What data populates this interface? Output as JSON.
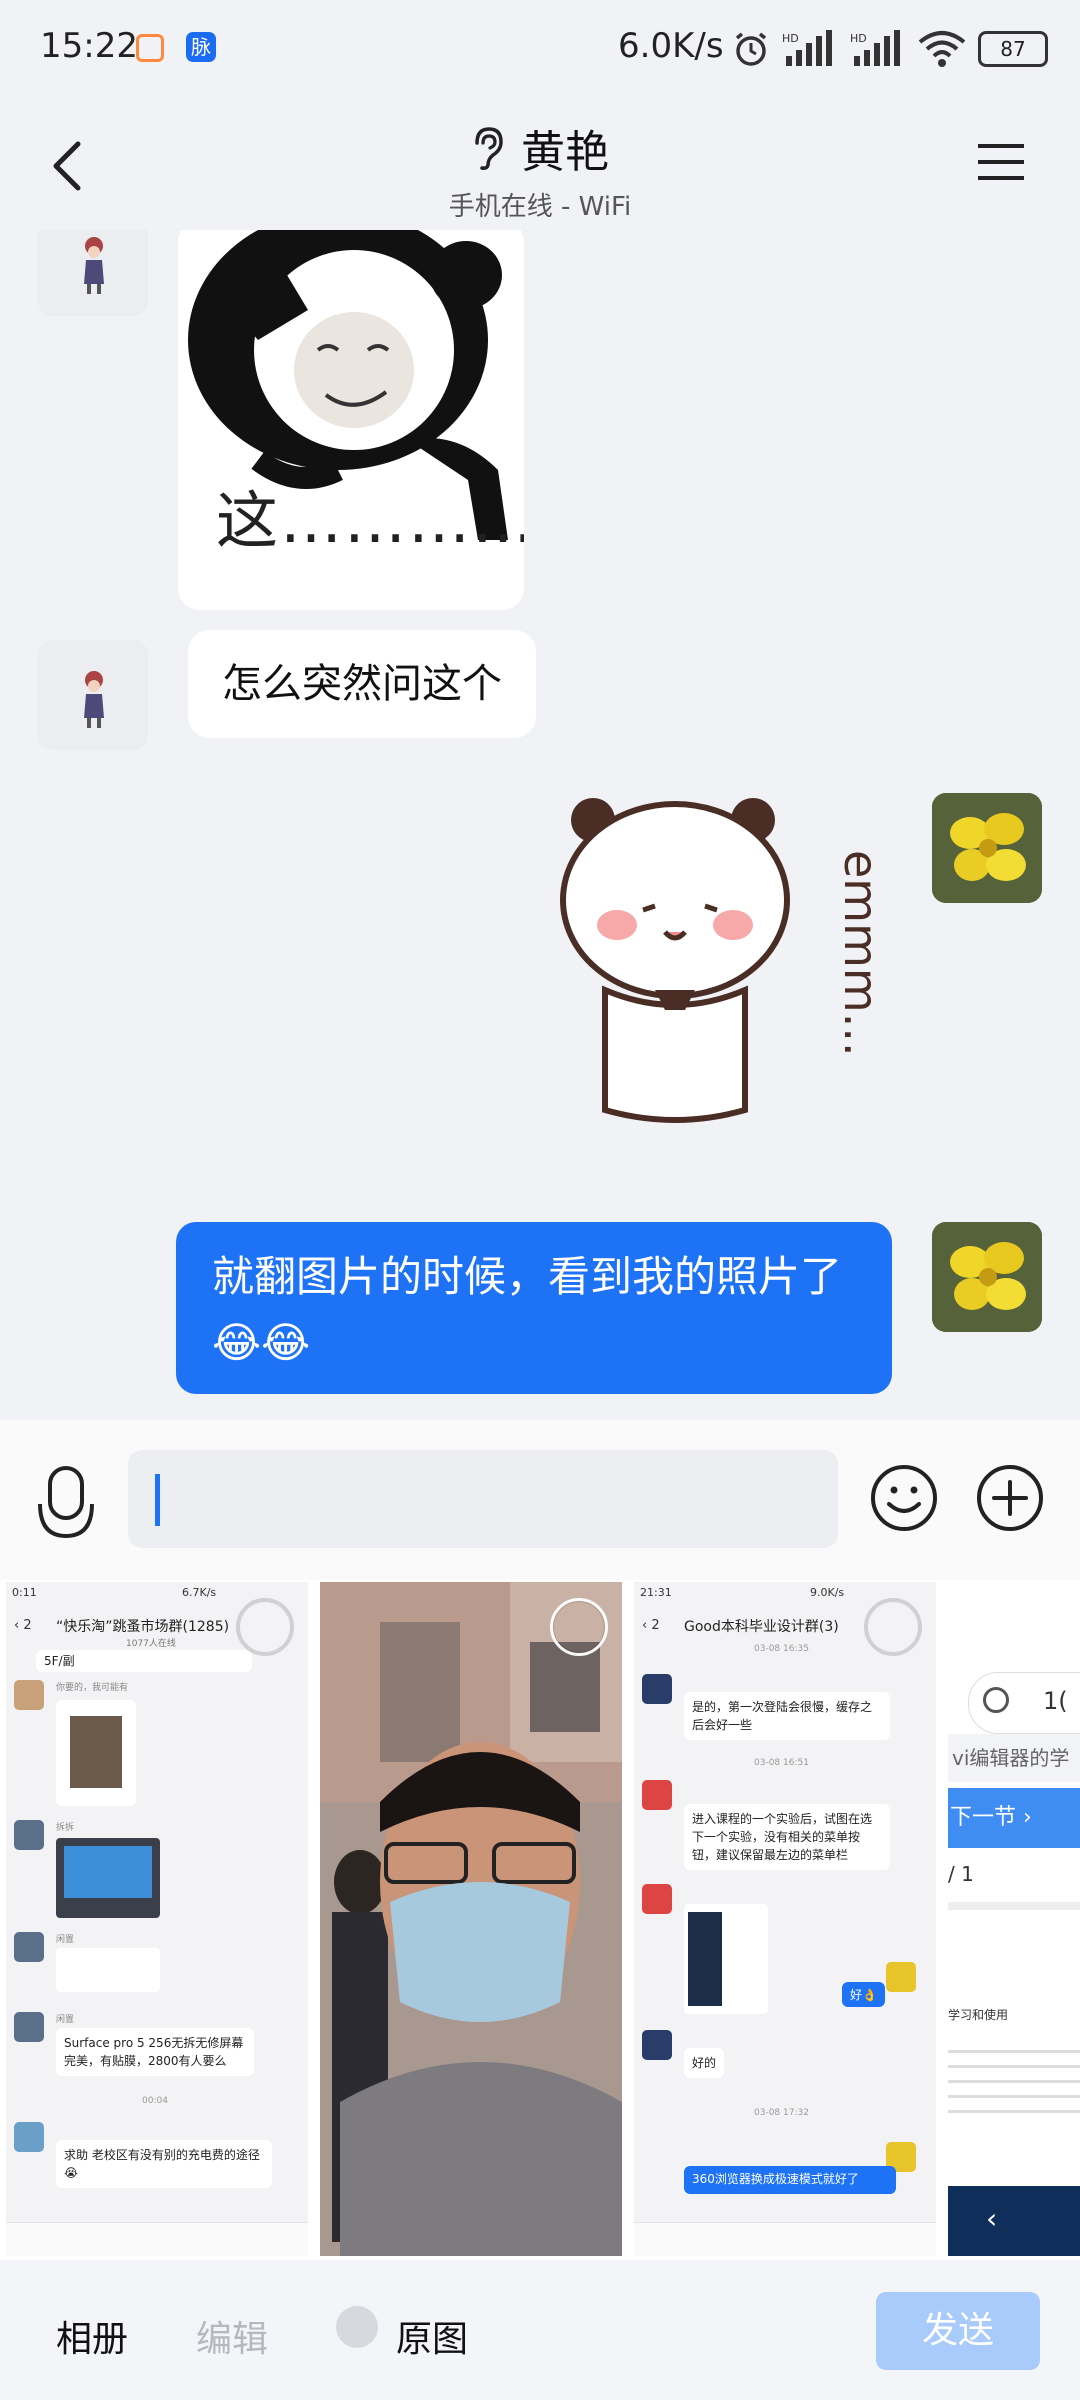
{
  "status_bar": {
    "time": "15:22",
    "app_badge_2": "脉",
    "net_speed": "6.0K/s",
    "signal_1_label": "HD",
    "signal_2_label": "HD",
    "battery": "87"
  },
  "header": {
    "title": "黄艳",
    "subtitle": "手机在线 - WiFi",
    "icons": [
      "back-arrow-icon",
      "ear-icon",
      "menu-icon"
    ]
  },
  "messages": [
    {
      "side": "left",
      "type": "sticker",
      "caption": "这…………"
    },
    {
      "side": "left",
      "type": "text",
      "text": "怎么突然问这个"
    },
    {
      "side": "right",
      "type": "sticker",
      "caption": "emmm..."
    },
    {
      "side": "right",
      "type": "text",
      "text": "就翻图片的时候，看到我的照片了😂😂"
    }
  ],
  "input": {
    "value": "",
    "icons": [
      "microphone-icon",
      "smile-icon",
      "plus-icon"
    ]
  },
  "gallery": {
    "thumb1": {
      "time": "0:11",
      "speed": "6.7K/s",
      "back_count": "2",
      "title": "“快乐淘”跳蚤市场群(1285)",
      "subtitle": "1077人在线",
      "frag": "5F/副",
      "sender1": "你要的，我可能有",
      "sender2": "拆拆",
      "sender3": "闲置",
      "sender4": "闲置",
      "msg1": "Surface pro 5 256无拆无修屏幕完美，有贴膜，2800有人要么",
      "timestamp": "00:04",
      "msg2": "求助 老校区有没有别的充电费的途径😭"
    },
    "thumb3": {
      "time": "21:31",
      "speed": "9.0K/s",
      "back_count": "2",
      "title": "Good本科毕业设计群(3)",
      "ts1": "03-08 16:35",
      "msg1": "是的，第一次登陆会很慢，缓存之后会好一些",
      "ts2": "03-08 16:51",
      "msg2": "进入课程的一个实验后，试图在选下一个实验，没有相关的菜单按钮，建议保留最左边的菜单栏",
      "msg3": "好👌",
      "msg4": "好的",
      "ts3": "03-08 17:32",
      "msg5": "360浏览器换成极速模式就好了"
    },
    "thumb4": {
      "frag1": "1(",
      "frag2": "vi编辑器的学",
      "next": "下一节",
      "page": "/ 1",
      "frag3": "学习和使用"
    }
  },
  "bottom_bar": {
    "album": "相册",
    "edit": "编辑",
    "original": "原图",
    "send": "发送"
  },
  "colors": {
    "accent": "#1e72f5",
    "send_disabled": "#a9cbfb",
    "background": "#f1f2f5"
  }
}
